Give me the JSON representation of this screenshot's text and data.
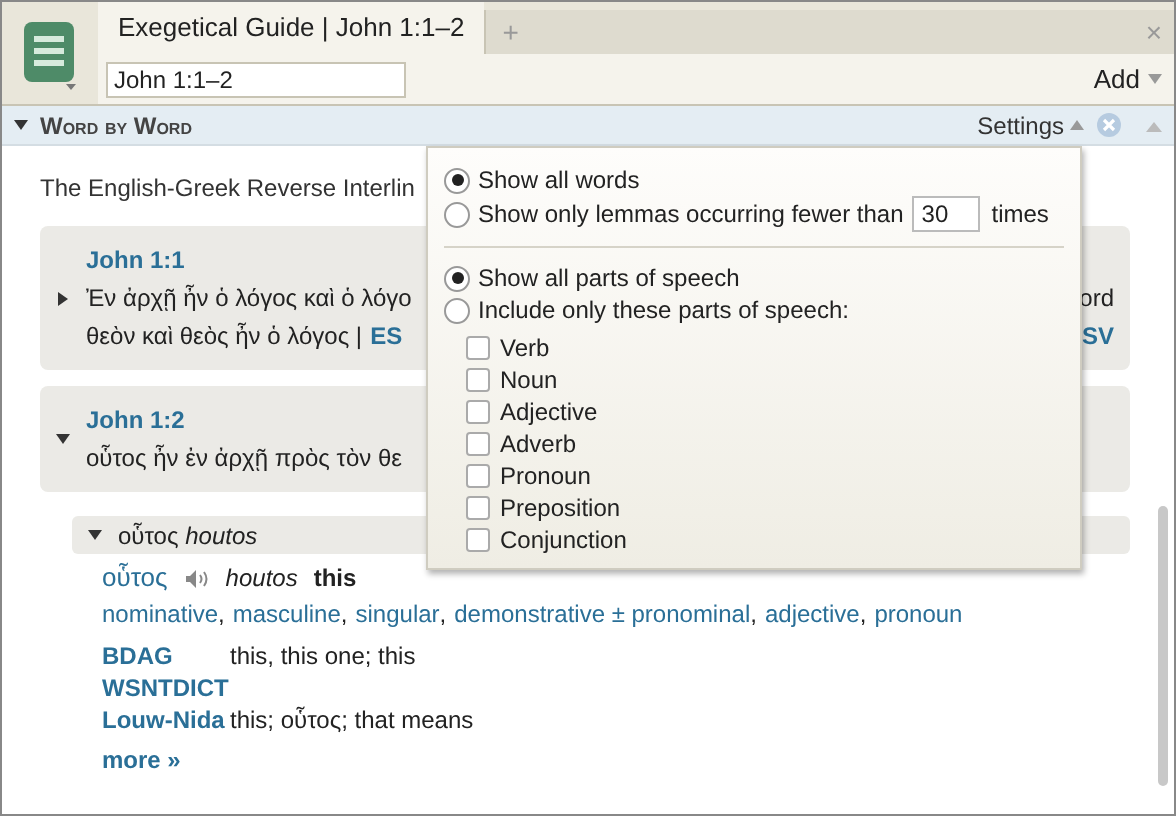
{
  "tabs": [
    {
      "label": "Exegetical Guide | John 1:1–2",
      "selected": true
    },
    {
      "label": "+",
      "selected": false
    }
  ],
  "tab_close": "×",
  "reference_field": {
    "value": "John 1:1–2"
  },
  "add_button": "Add",
  "panel": {
    "title": "Word by Word",
    "expanded": true,
    "settings": "Settings"
  },
  "intro": "The English-Greek Reverse Interlin",
  "verses": [
    {
      "reference": "John 1:1",
      "expanded": false,
      "line_1": "Ἐν ἀρχῇ ἦν ὁ λόγος καὶ ὁ λόγο",
      "line_1_end": "ord",
      "line_2": "θεὸν καὶ θεὸς ἦν ὁ λόγος  |",
      "line_2_link": "ES",
      "line_2_end": "SV"
    },
    {
      "reference": "John 1:2",
      "expanded": true,
      "line_1": "οὗτος ἦν ἐν ἀρχῇ πρὸς τὸν θε"
    }
  ],
  "word": {
    "expanded": true,
    "heading": "οὗτος",
    "heading_translit": "houtos",
    "lemma": "οὗτος",
    "translit": "houtos",
    "gloss": "this",
    "parsing_separator": ",",
    "parsing": [
      "nominative",
      "masculine",
      "singular",
      "demonstrative ± pronominal",
      "adjective",
      "pronoun"
    ],
    "lexicons": [
      {
        "name": "BDAG",
        "definition": "this, this one; this"
      },
      {
        "name": "WSNTDICT"
      },
      {
        "name": "Louw-Nida",
        "definition": "this; οὗτος; that means"
      }
    ],
    "more": "more »"
  },
  "settings_popup": {
    "word_options": [
      {
        "label": "Show all words",
        "selected": true
      },
      {
        "label": "Show only lemmas occurring fewer than",
        "selected": false,
        "count": "30",
        "suffix": "times"
      }
    ],
    "pos_options": [
      {
        "label": "Show all parts of speech",
        "selected": true
      },
      {
        "label": "Include only these parts of speech:",
        "selected": false
      }
    ],
    "parts_of_speech": [
      {
        "label": "Verb",
        "checked": false
      },
      {
        "label": "Noun",
        "checked": false
      },
      {
        "label": "Adjective",
        "checked": false
      },
      {
        "label": "Adverb",
        "checked": false
      },
      {
        "label": "Pronoun",
        "checked": false
      },
      {
        "label": "Preposition",
        "checked": false
      },
      {
        "label": "Conjunction",
        "checked": false
      }
    ]
  }
}
